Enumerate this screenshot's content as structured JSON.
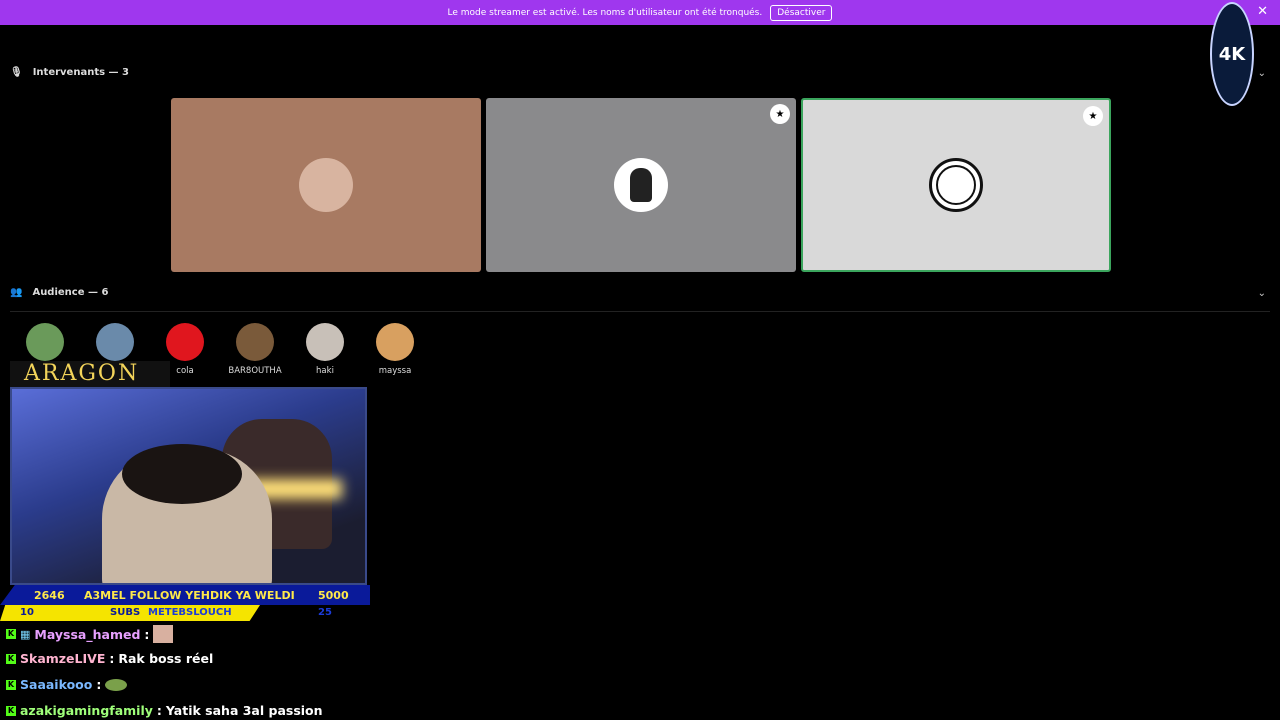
{
  "banner": {
    "message": "Le mode streamer est activé. Les noms d'utilisateur ont été tronqués.",
    "button": "Désactiver",
    "close": "✕"
  },
  "logo_text": "4K",
  "speakers": {
    "title": "Intervenants — 3",
    "tiles": [
      {
        "bg": "#a87a62"
      },
      {
        "bg": "#8a8a8c"
      },
      {
        "bg": "#d9d9d9",
        "active": true
      }
    ]
  },
  "audience": {
    "title": "Audience — 6",
    "members": [
      {
        "name": ""
      },
      {
        "name": ""
      },
      {
        "name": "cola"
      },
      {
        "name": "BAR8OUTHA"
      },
      {
        "name": "haki"
      },
      {
        "name": "mayssa"
      }
    ]
  },
  "overlay": {
    "aragon": "ARAGON",
    "ticker_left_top": "2646",
    "ticker_left_bottom": "10",
    "ticker_msg": "A3MEL FOLLOW YEHDIK YA WELDI",
    "ticker_subs": "SUBS",
    "ticker_name": "METEBSLOUCH",
    "ticker_right_top": "5000",
    "ticker_right_bottom": "25"
  },
  "chat": [
    {
      "user": "Mayssa_hamed",
      "color": "#e8a0ff",
      "text": ""
    },
    {
      "user": "SkamzeLIVE",
      "color": "#ffb4d0",
      "text": "Rak boss réel"
    },
    {
      "user": "Saaaikooo",
      "color": "#7ab8ff",
      "text": ""
    },
    {
      "user": "azakigamingfamily",
      "color": "#9fff7a",
      "text": "Yatik saha 3al passion"
    }
  ]
}
